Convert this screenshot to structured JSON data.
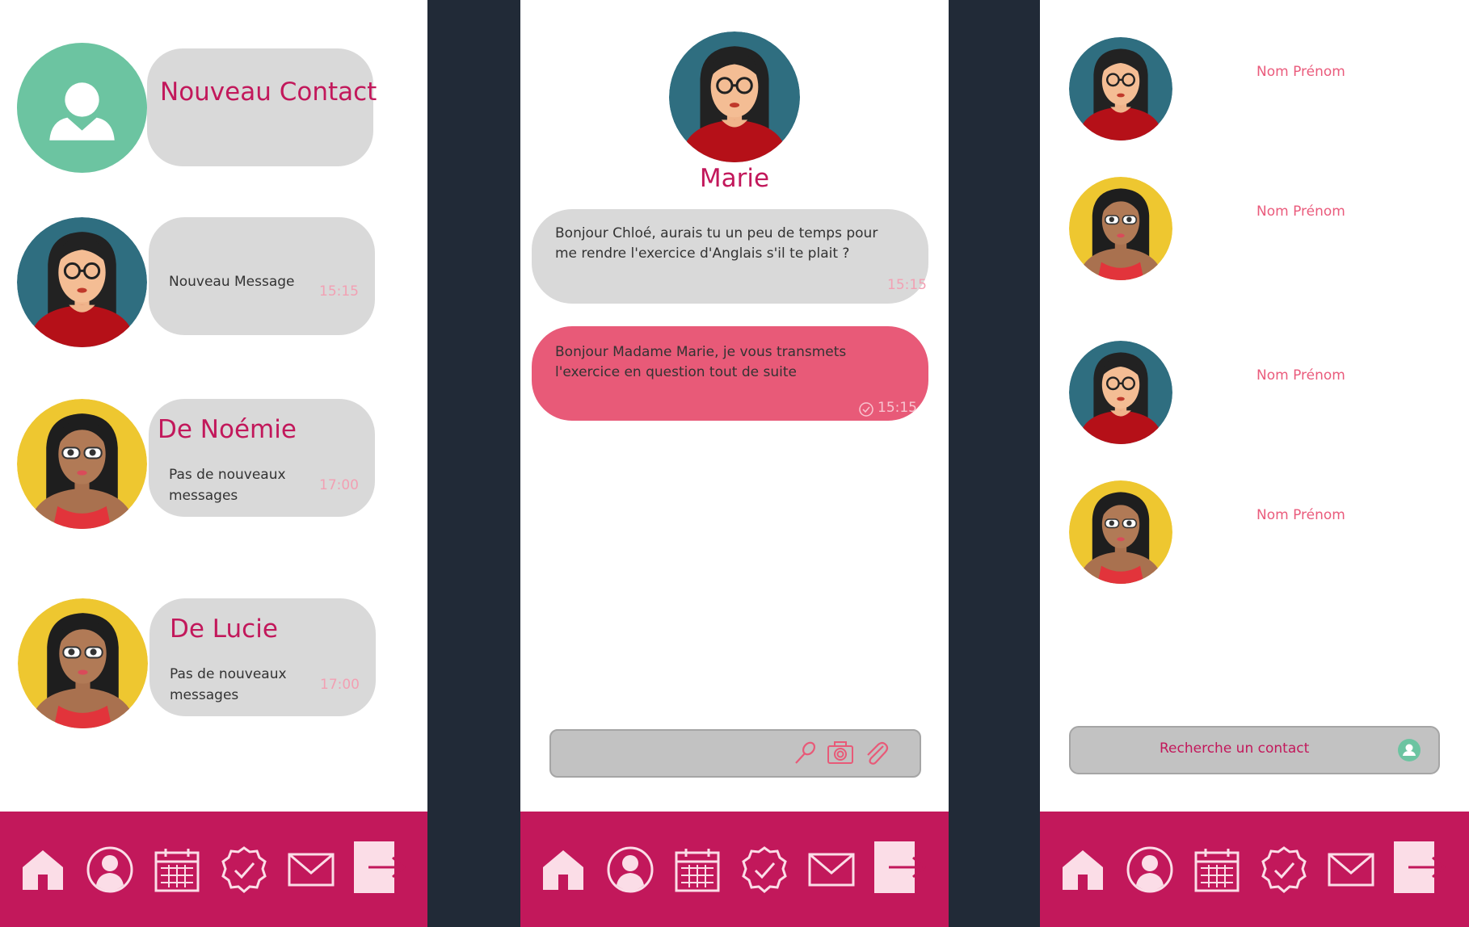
{
  "screen1": {
    "new_contact": {
      "label": "Nouveau Contact"
    },
    "conversations": [
      {
        "title": "",
        "preview": "Nouveau Message",
        "time": "15:15"
      },
      {
        "title": "De Noémie",
        "preview": "Pas de nouveaux messages",
        "time": "17:00"
      },
      {
        "title": "De Lucie",
        "preview": "Pas de nouveaux messages",
        "time": "17:00"
      }
    ]
  },
  "screen2": {
    "contact_name": "Marie",
    "messages": [
      {
        "text": "Bonjour Chloé, aurais tu un peu de temps pour me rendre l'exercice d'Anglais s'il te plait ?",
        "time": "15:15",
        "direction": "incoming"
      },
      {
        "text": "Bonjour Madame Marie, je vous transmets l'exercice en question tout de suite",
        "time": "15:15",
        "direction": "outgoing"
      }
    ],
    "composer_icons": [
      "microphone-icon",
      "camera-icon",
      "paperclip-icon"
    ]
  },
  "screen3": {
    "contacts": [
      {
        "name": "Nom Prénom"
      },
      {
        "name": "Nom Prénom"
      },
      {
        "name": "Nom Prénom"
      },
      {
        "name": "Nom Prénom"
      }
    ],
    "search": {
      "label": "Recherche un contact"
    }
  },
  "navbar_icons": [
    "home-icon",
    "profile-icon",
    "calendar-icon",
    "tasks-icon",
    "mail-icon",
    "logout-icon"
  ],
  "colors": {
    "brand": "#c2185b",
    "bubble_grey": "#d9d9d9",
    "outgoing_bubble": "#e85a78",
    "time_pink": "#f2a0b3",
    "contact_name_pink": "#ea5b7c",
    "new_contact_green": "#6cc4a1",
    "divider_navy": "#212a37"
  }
}
